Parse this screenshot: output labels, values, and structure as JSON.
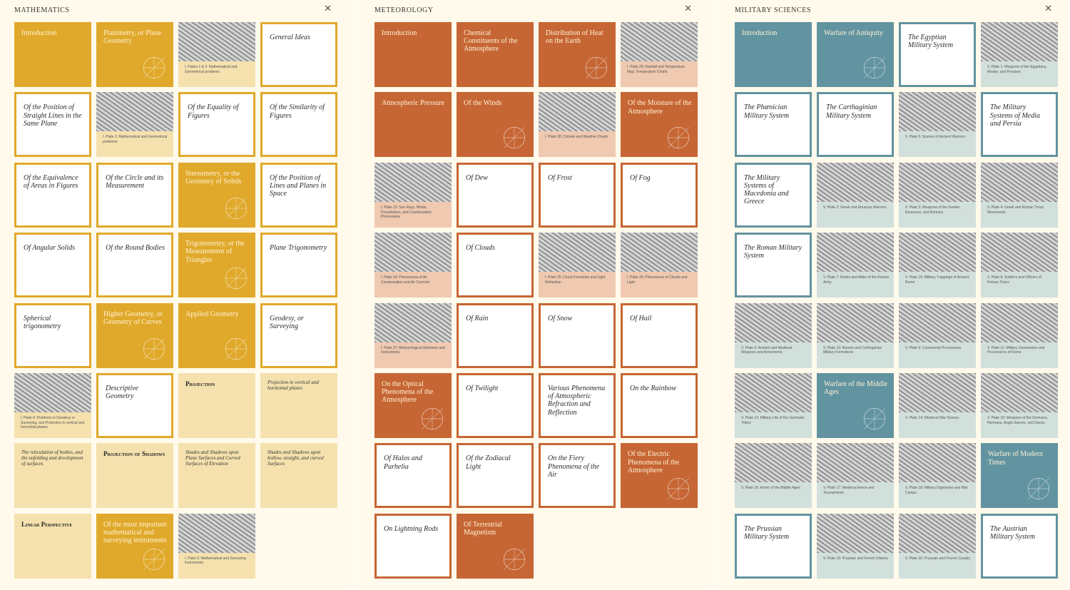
{
  "colors": {
    "math": "#e0a92b",
    "math_pale": "#f4e1ae",
    "meteo": "#c66634",
    "meteo_pale": "#efc9b0",
    "mil": "#6293a0",
    "mil_pale": "#d2e0dc"
  },
  "panels": [
    {
      "key": "math",
      "title": "MATHEMATICS",
      "close": "✕",
      "tiles": [
        {
          "kind": "solid",
          "label": "Introduction"
        },
        {
          "kind": "solid",
          "label": "Planimetry, or Plane Geometry",
          "deco": true
        },
        {
          "kind": "plate",
          "caption": "I. Plates 1 & 2: Mathematical and Geometrical problems"
        },
        {
          "kind": "outline",
          "label": "General Ideas"
        },
        {
          "kind": "outline",
          "label": "Of the Position of Straight Lines in the Same Plane"
        },
        {
          "kind": "plate",
          "caption": "I. Plate 3: Mathematical and Geometrical problems"
        },
        {
          "kind": "outline",
          "label": "Of the Equality of Figures"
        },
        {
          "kind": "outline",
          "label": "Of the Similarity of Figures"
        },
        {
          "kind": "outline",
          "label": "Of the Equivalence of Areas in Figures"
        },
        {
          "kind": "outline",
          "label": "Of the Circle and its Measurement"
        },
        {
          "kind": "solid",
          "label": "Stereometry, or the Geometry of Solids",
          "deco": true
        },
        {
          "kind": "outline",
          "label": "Of the Position of Lines and Planes in Space"
        },
        {
          "kind": "outline",
          "label": "Of Angular Solids"
        },
        {
          "kind": "outline",
          "label": "Of the Round Bodies"
        },
        {
          "kind": "solid",
          "label": "Trigonometry, or the Measurement of Triangles",
          "deco": true
        },
        {
          "kind": "outline",
          "label": "Plane Trigonometry"
        },
        {
          "kind": "outline",
          "label": "Spherical trigonometry"
        },
        {
          "kind": "solid",
          "label": "Higher Geometry, or Geometry of Curves",
          "deco": true
        },
        {
          "kind": "solid",
          "label": "Applied Geometry",
          "deco": true
        },
        {
          "kind": "outline",
          "label": "Geodesy, or Surveying"
        },
        {
          "kind": "plate",
          "caption": "I. Plate 4: Problems in Geodesy or Surveying, and Projection in vertical and horizontal planes"
        },
        {
          "kind": "outline",
          "label": "Descriptive Geometry"
        },
        {
          "kind": "pale",
          "style": "sc",
          "label": "Projection"
        },
        {
          "kind": "pale",
          "style": "sm",
          "label": "Projection in vertical and horizontal planes"
        },
        {
          "kind": "pale",
          "style": "sm",
          "label": "The reticulation of bodies, and the unfolding and development of surfaces"
        },
        {
          "kind": "pale",
          "style": "sc",
          "label": "Projection of Shadows"
        },
        {
          "kind": "pale",
          "style": "sm",
          "label": "Shades and Shadows upon Plane Surfaces and Curved Surfaces of Elevation"
        },
        {
          "kind": "pale",
          "style": "sm",
          "label": "Shades and Shadows upon hollow, straight, and curved Surfaces"
        },
        {
          "kind": "pale",
          "style": "sc",
          "label": "Linear Perspective"
        },
        {
          "kind": "solid",
          "label": "Of the most important mathematical and surveying instruments",
          "deco": true
        },
        {
          "kind": "plate",
          "caption": "I. Plate 5: Mathematical and Surveying Instruments"
        }
      ]
    },
    {
      "key": "meteo",
      "title": "METEOROLOGY",
      "close": "✕",
      "tiles": [
        {
          "kind": "solid",
          "label": "Introduction"
        },
        {
          "kind": "solid",
          "label": "Chemical Constituents of the Atmosphere"
        },
        {
          "kind": "solid",
          "label": "Distribution of Heat on the Earth",
          "deco": true
        },
        {
          "kind": "plate",
          "caption": "I. Plate 29: Rainfall and Temperature Map, Temperature Charts"
        },
        {
          "kind": "solid",
          "label": "Atmospheric Pressure"
        },
        {
          "kind": "solid",
          "label": "Of the Winds",
          "deco": true
        },
        {
          "kind": "plate",
          "caption": "I. Plate 28: Climate and Weather Charts"
        },
        {
          "kind": "solid",
          "label": "Of the Moisture of the Atmosphere",
          "deco": true
        },
        {
          "kind": "plate",
          "caption": "I. Plate 23: Sun Rays, Winds, Precipitation, and Condensation Phenomena"
        },
        {
          "kind": "outline",
          "label": "Of Dew"
        },
        {
          "kind": "outline",
          "label": "Of Frost"
        },
        {
          "kind": "outline",
          "label": "Of Fog"
        },
        {
          "kind": "plate",
          "caption": "I. Plate 24: Phenomena of Air Condensation and Air Currents"
        },
        {
          "kind": "outline",
          "label": "Of Clouds"
        },
        {
          "kind": "plate",
          "caption": "I. Plate 25: Cloud Formation and Light Refraction"
        },
        {
          "kind": "plate",
          "caption": "I. Plate 26: Phenomena of Clouds and Light"
        },
        {
          "kind": "plate",
          "caption": "I. Plate 27: Meteorological Elements and Instruments"
        },
        {
          "kind": "outline",
          "label": "Of Rain"
        },
        {
          "kind": "outline",
          "label": "Of Snow"
        },
        {
          "kind": "outline",
          "label": "Of Hail"
        },
        {
          "kind": "solid",
          "label": "On the Optical Phenomena of the Atmosphere",
          "deco": true
        },
        {
          "kind": "outline",
          "label": "Of Twilight"
        },
        {
          "kind": "outline",
          "label": "Various Phenomena of Atmospheric Refraction and Reflection"
        },
        {
          "kind": "outline",
          "label": "On the Rainbow"
        },
        {
          "kind": "outline",
          "label": "Of Halos and Parhelia"
        },
        {
          "kind": "outline",
          "label": "Of the Zodiacal Light"
        },
        {
          "kind": "outline",
          "label": "On the Fiery Phenomena of the Air"
        },
        {
          "kind": "solid",
          "label": "Of the Electric Phenomena of the Atmosphere",
          "deco": true
        },
        {
          "kind": "outline",
          "label": "On Lightning Rods"
        },
        {
          "kind": "solid",
          "label": "Of Terrestrial Magnetism",
          "deco": true
        }
      ]
    },
    {
      "key": "mil",
      "title": "MILITARY SCIENCES",
      "close": "✕",
      "tiles": [
        {
          "kind": "solid",
          "label": "Introduction"
        },
        {
          "kind": "solid",
          "label": "Warfare of Antiquity",
          "deco": true
        },
        {
          "kind": "outline",
          "label": "The Egyptian Military System"
        },
        {
          "kind": "plate",
          "caption": "V. Plate 1: Weapons of the Egyptians, Medes, and Persians"
        },
        {
          "kind": "outline",
          "label": "The Phœnician Military System"
        },
        {
          "kind": "outline",
          "label": "The Carthaginian Military System"
        },
        {
          "kind": "plate",
          "caption": "V. Plate 5: Scenes of Ancient Warriors"
        },
        {
          "kind": "outline",
          "label": "The Military Systems of Media and Persia"
        },
        {
          "kind": "outline",
          "label": "The Military Systems of Macedonia and Greece"
        },
        {
          "kind": "plate",
          "caption": "V. Plate 2: Greek and Etruscan Warriors"
        },
        {
          "kind": "plate",
          "caption": "V. Plate 3: Weapons of the Greeks, Etruscans, and Romans"
        },
        {
          "kind": "plate",
          "caption": "V. Plate 4: Greek and Roman Troop Movements"
        },
        {
          "kind": "outline",
          "label": "The Roman Military System"
        },
        {
          "kind": "plate",
          "caption": "V. Plate 7: Ranks and Allies of the Roman Army"
        },
        {
          "kind": "plate",
          "caption": "V. Plate 10: Military Trappings of Ancient Rome"
        },
        {
          "kind": "plate",
          "caption": "V. Plate 8: Soldiers and Officers of Roman Times"
        },
        {
          "kind": "plate",
          "caption": "V. Plate 9: Ancient and Medieval Weapons and Armaments"
        },
        {
          "kind": "plate",
          "caption": "V. Plate 13: Roman and Carthaginian Military Formations"
        },
        {
          "kind": "plate",
          "caption": "V. Plate 6: Ceremonial Processions"
        },
        {
          "kind": "plate",
          "caption": "V. Plate 11: Military Ceremonies and Processions of Rome"
        },
        {
          "kind": "plate",
          "caption": "V. Plate 12: Military Life of the Germanic Tribes"
        },
        {
          "kind": "solid",
          "label": "Warfare of the Middle Ages",
          "deco": true
        },
        {
          "kind": "plate",
          "caption": "V. Plate 14: Medieval War Scenes"
        },
        {
          "kind": "plate",
          "caption": "V. Plate 15: Weapons of the Germans, Normans, Anglo-Saxons, and Danes"
        },
        {
          "kind": "plate",
          "caption": "V. Plate 16: Armor of the Middle Ages"
        },
        {
          "kind": "plate",
          "caption": "V. Plate 17: Medieval Armor and Tournaments"
        },
        {
          "kind": "plate",
          "caption": "V. Plate 18: Military Dignitaries and War Camps"
        },
        {
          "kind": "solid",
          "label": "Warfare of Modern Times",
          "deco": true
        },
        {
          "kind": "outline",
          "label": "The Prussian Military System"
        },
        {
          "kind": "plate",
          "caption": "V. Plate 19: Prussian and French Infantry"
        },
        {
          "kind": "plate",
          "caption": "V. Plate 20: Prussian and French Cavalry"
        },
        {
          "kind": "outline",
          "label": "The Austrian Military System"
        }
      ]
    }
  ]
}
